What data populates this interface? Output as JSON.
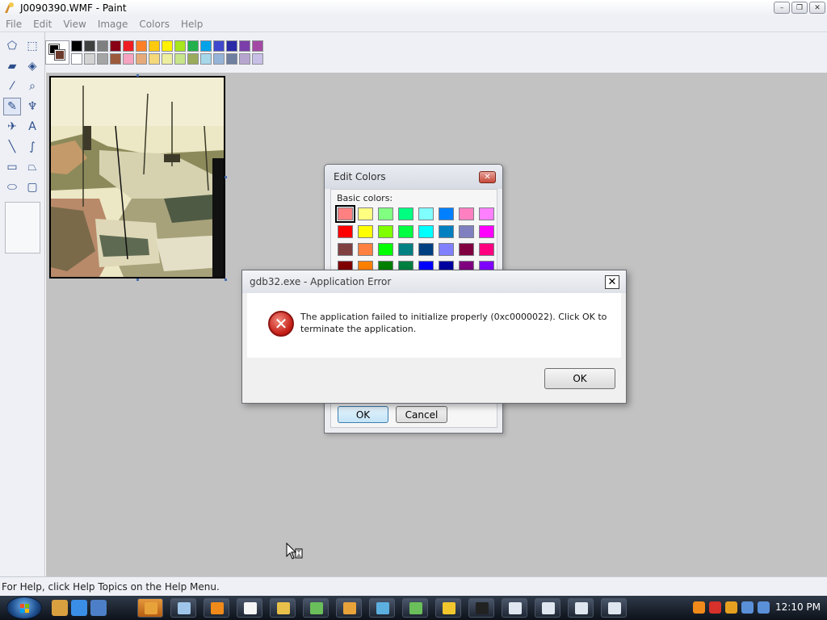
{
  "window": {
    "title": "J0090390.WMF - Paint",
    "buttons": {
      "minimize": "–",
      "maximize": "❐",
      "close": "✕"
    }
  },
  "menu": [
    "File",
    "Edit",
    "View",
    "Image",
    "Colors",
    "Help"
  ],
  "palette": {
    "foreground": "#000000",
    "background": "#6b3a2a",
    "row1": [
      "#000000",
      "#404040",
      "#7f7f7f",
      "#880015",
      "#ed1c24",
      "#ff7f27",
      "#ffc90e",
      "#fff200",
      "#a8e61d",
      "#22b14c",
      "#00a2e8",
      "#3f48cc",
      "#2b2ba8",
      "#7a3fa8",
      "#a349a4"
    ],
    "row2": [
      "#ffffff",
      "#d3d3d3",
      "#a5a5a5",
      "#9c5a3c",
      "#f5a3c0",
      "#e5aa7a",
      "#f5d87a",
      "#eeeea0",
      "#c7e58a",
      "#9aac5c",
      "#a6d8ea",
      "#96b4d8",
      "#6f7fa0",
      "#b6a6cf",
      "#c8bfe7"
    ]
  },
  "tools": [
    {
      "name": "free-form-select-icon",
      "glyph": "⬠"
    },
    {
      "name": "select-icon",
      "glyph": "⬚"
    },
    {
      "name": "eraser-icon",
      "glyph": "▰"
    },
    {
      "name": "fill-icon",
      "glyph": "◈"
    },
    {
      "name": "pick-color-icon",
      "glyph": "⁄"
    },
    {
      "name": "magnifier-icon",
      "glyph": "⌕"
    },
    {
      "name": "pencil-icon",
      "glyph": "✎"
    },
    {
      "name": "brush-icon",
      "glyph": "♆"
    },
    {
      "name": "airbrush-icon",
      "glyph": "✈"
    },
    {
      "name": "text-icon",
      "glyph": "A"
    },
    {
      "name": "line-icon",
      "glyph": "╲"
    },
    {
      "name": "curve-icon",
      "glyph": "∫"
    },
    {
      "name": "rectangle-icon",
      "glyph": "▭"
    },
    {
      "name": "polygon-icon",
      "glyph": "⏢"
    },
    {
      "name": "ellipse-icon",
      "glyph": "⬭"
    },
    {
      "name": "rounded-rectangle-icon",
      "glyph": "▢"
    }
  ],
  "edit_colors": {
    "title": "Edit Colors",
    "close_label": "✕",
    "basic_colors_label": "Basic colors:",
    "basic_colors": [
      "#ff8080",
      "#ffff80",
      "#80ff80",
      "#00ff80",
      "#80ffff",
      "#0080ff",
      "#ff80c0",
      "#ff80ff",
      "#ff0000",
      "#ffff00",
      "#80ff00",
      "#00ff40",
      "#00ffff",
      "#0080c0",
      "#8080c0",
      "#ff00ff",
      "#804040",
      "#ff8040",
      "#00ff00",
      "#008080",
      "#004080",
      "#8080ff",
      "#800040",
      "#ff0080",
      "#800000",
      "#ff8000",
      "#008000",
      "#008040",
      "#0000ff",
      "#0000a0",
      "#800080",
      "#8000ff"
    ],
    "ok_label": "OK",
    "cancel_label": "Cancel"
  },
  "app_error": {
    "title": "gdb32.exe - Application Error",
    "close_label": "✕",
    "message": "The application failed to initialize properly (0xc0000022). Click OK to terminate the application.",
    "ok_label": "OK"
  },
  "status": {
    "help_text": "For Help, click Help Topics on the Help Menu."
  },
  "taskbar": {
    "clock": "12:10 PM",
    "quicklaunch": [
      "#d9a040",
      "#3a8ee6",
      "#4c7fc7"
    ],
    "buttons": [
      "#e8a23a",
      "#9fc6ea",
      "#f08a1a",
      "#f5f5f5",
      "#e8c04a",
      "#6bbf5a",
      "#e8a23a",
      "#5cb0e0",
      "#6bbf5a",
      "#f2c72d",
      "#222222",
      "#dfe6ef",
      "#dfe6ef",
      "#dfe6ef",
      "#dfe6ef"
    ],
    "tray": [
      "#f08a1a",
      "#d8302a",
      "#e6a020",
      "#5a90d8",
      "#5a90d8"
    ]
  }
}
